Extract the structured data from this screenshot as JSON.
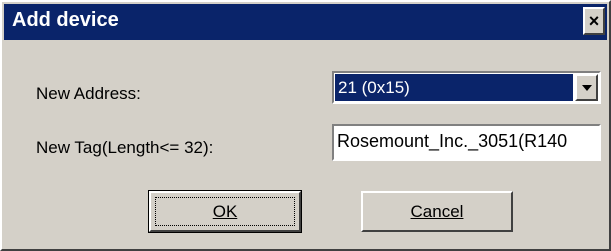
{
  "window": {
    "title": "Add device",
    "close_symbol": "×"
  },
  "form": {
    "address_label": "New Address:",
    "address_value": "21 (0x15)",
    "tag_label": "New Tag(Length<= 32):",
    "tag_value": "Rosemount_Inc._3051(R140"
  },
  "buttons": {
    "ok_label": "OK",
    "cancel_label": "Cancel"
  },
  "icons": {
    "close": "close-icon",
    "dropdown": "chevron-down-icon"
  },
  "colors": {
    "titlebar": "#0a246a",
    "dialog_face": "#d4d0c8",
    "selection": "#0a246a"
  }
}
